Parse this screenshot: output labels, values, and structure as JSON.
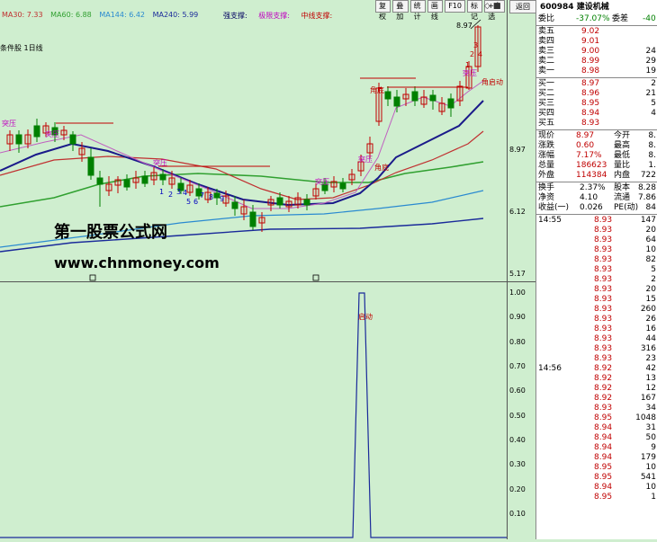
{
  "colors": {
    "background": "#cfeecf",
    "up": "#c00000",
    "down": "#008000",
    "ma30": "#c03030",
    "ma60": "#30a030",
    "ma144": "#2a8ad0",
    "ma240": "#1a2a9a"
  },
  "ma_legend": [
    {
      "text": "MA30: 7.33",
      "color": "#c03030"
    },
    {
      "text": "MA60: 6.88",
      "color": "#30a030"
    },
    {
      "text": "MA144: 6.42",
      "color": "#2a8ad0"
    },
    {
      "text": "MA240: 5.99",
      "color": "#1a2a9a"
    }
  ],
  "support_legend": [
    "强支撑:",
    "极限支撑:",
    "中线支撑:"
  ],
  "condition_label": "条件股 1日线",
  "toolbar": [
    "复权",
    "叠加",
    "统计",
    "画线",
    "F10",
    "标记",
    "+自选",
    "返回"
  ],
  "chart_labels": {
    "tupo": "突压",
    "jiaodi": "角底",
    "jiaoqidong": "角启动",
    "peak_price": "8.97",
    "seq": [
      "1",
      "2",
      "3",
      "4",
      "5",
      "6",
      "7",
      "8",
      "9"
    ],
    "seq2": [
      "1",
      "2",
      "3",
      "4"
    ],
    "indicator_label": "启动"
  },
  "price_scale": [
    "8.97",
    "6.12",
    "5.17"
  ],
  "indicator_scale": [
    "1.00",
    "0.90",
    "0.80",
    "0.70",
    "0.60",
    "0.50",
    "0.40",
    "0.30",
    "0.20",
    "0.10"
  ],
  "watermark": {
    "line1": "第一股票公式网",
    "line2": "www.chnmoney.com"
  },
  "quote": {
    "code": "600984",
    "name": "建设机械",
    "weibi": {
      "label": "委比",
      "value": "-37.07%",
      "label2": "委差",
      "value2": "-40"
    },
    "sells": [
      {
        "label": "卖五",
        "price": "9.02",
        "vol": ""
      },
      {
        "label": "卖四",
        "price": "9.01",
        "vol": ""
      },
      {
        "label": "卖三",
        "price": "9.00",
        "vol": "24"
      },
      {
        "label": "卖二",
        "price": "8.99",
        "vol": "29"
      },
      {
        "label": "卖一",
        "price": "8.98",
        "vol": "19"
      }
    ],
    "buys": [
      {
        "label": "买一",
        "price": "8.97",
        "vol": "2"
      },
      {
        "label": "买二",
        "price": "8.96",
        "vol": "21"
      },
      {
        "label": "买三",
        "price": "8.95",
        "vol": "5"
      },
      {
        "label": "买四",
        "price": "8.94",
        "vol": "4"
      },
      {
        "label": "买五",
        "price": "8.93",
        "vol": ""
      }
    ],
    "stats": [
      {
        "l1": "现价",
        "v1": "8.97",
        "l2": "今开",
        "v2": "8."
      },
      {
        "l1": "涨跌",
        "v1": "0.60",
        "l2": "最高",
        "v2": "8."
      },
      {
        "l1": "涨幅",
        "v1": "7.17%",
        "l2": "最低",
        "v2": "8."
      },
      {
        "l1": "总量",
        "v1": "186623",
        "l2": "量比",
        "v2": "1."
      },
      {
        "l1": "外盘",
        "v1": "114384",
        "l2": "内盘",
        "v2": "722"
      }
    ],
    "stats2": [
      {
        "l1": "换手",
        "v1": "2.37%",
        "l2": "股本",
        "v2": "8.28"
      },
      {
        "l1": "净资",
        "v1": "4.10",
        "l2": "流通",
        "v2": "7.86"
      },
      {
        "l1": "收益(一)",
        "v1": "0.026",
        "l2": "PE(动)",
        "v2": "84"
      }
    ],
    "ticks": [
      {
        "time": "14:55",
        "price": "8.93",
        "vol": "147"
      },
      {
        "time": "",
        "price": "8.93",
        "vol": "20"
      },
      {
        "time": "",
        "price": "8.93",
        "vol": "64"
      },
      {
        "time": "",
        "price": "8.93",
        "vol": "10"
      },
      {
        "time": "",
        "price": "8.93",
        "vol": "82"
      },
      {
        "time": "",
        "price": "8.93",
        "vol": "5"
      },
      {
        "time": "",
        "price": "8.93",
        "vol": "2"
      },
      {
        "time": "",
        "price": "8.93",
        "vol": "20"
      },
      {
        "time": "",
        "price": "8.93",
        "vol": "15"
      },
      {
        "time": "",
        "price": "8.93",
        "vol": "260"
      },
      {
        "time": "",
        "price": "8.93",
        "vol": "26"
      },
      {
        "time": "",
        "price": "8.93",
        "vol": "16"
      },
      {
        "time": "",
        "price": "8.93",
        "vol": "44"
      },
      {
        "time": "",
        "price": "8.93",
        "vol": "316"
      },
      {
        "time": "",
        "price": "8.93",
        "vol": "23"
      },
      {
        "time": "14:56",
        "price": "8.92",
        "vol": "42"
      },
      {
        "time": "",
        "price": "8.92",
        "vol": "13"
      },
      {
        "time": "",
        "price": "8.92",
        "vol": "12"
      },
      {
        "time": "",
        "price": "8.92",
        "vol": "167"
      },
      {
        "time": "",
        "price": "8.93",
        "vol": "34"
      },
      {
        "time": "",
        "price": "8.95",
        "vol": "1048"
      },
      {
        "time": "",
        "price": "8.94",
        "vol": "31"
      },
      {
        "time": "",
        "price": "8.94",
        "vol": "50"
      },
      {
        "time": "",
        "price": "8.94",
        "vol": "9"
      },
      {
        "time": "",
        "price": "8.94",
        "vol": "179"
      },
      {
        "time": "",
        "price": "8.95",
        "vol": "10"
      },
      {
        "time": "",
        "price": "8.95",
        "vol": "541"
      },
      {
        "time": "",
        "price": "8.94",
        "vol": "10"
      },
      {
        "time": "",
        "price": "8.95",
        "vol": "1"
      }
    ]
  }
}
